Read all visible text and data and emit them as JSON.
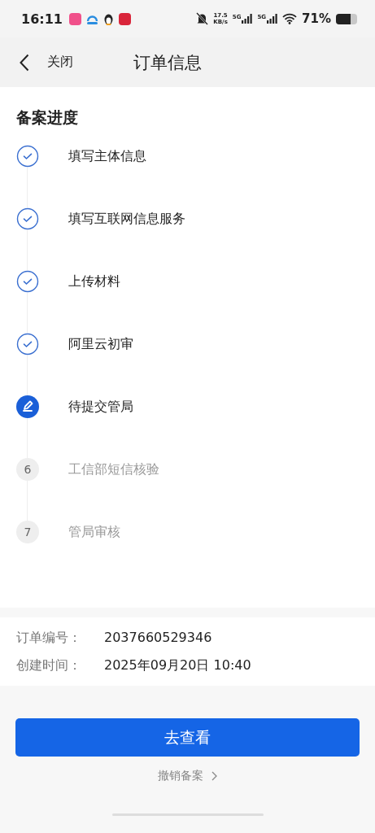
{
  "status_bar": {
    "time": "16:11",
    "speed": "17.5",
    "speed_unit": "KB/s",
    "networks": [
      "5G",
      "5G"
    ],
    "battery": "71%"
  },
  "header": {
    "back_label": "关闭",
    "title": "订单信息"
  },
  "progress": {
    "title": "备案进度",
    "steps": [
      {
        "kind": "done",
        "label": "填写主体信息"
      },
      {
        "kind": "done",
        "label": "填写互联网信息服务"
      },
      {
        "kind": "done",
        "label": "上传材料"
      },
      {
        "kind": "done",
        "label": "阿里云初审"
      },
      {
        "kind": "current",
        "label": "待提交管局"
      },
      {
        "kind": "pending",
        "number": "6",
        "label": "工信部短信核验"
      },
      {
        "kind": "pending",
        "number": "7",
        "label": "管局审核"
      }
    ]
  },
  "order": [
    {
      "label": "订单编号：",
      "value": "2037660529346"
    },
    {
      "label": "创建时间：",
      "value": "2025年09月20日 10:40"
    }
  ],
  "actions": {
    "primary": "去查看",
    "secondary": "撤销备案"
  }
}
